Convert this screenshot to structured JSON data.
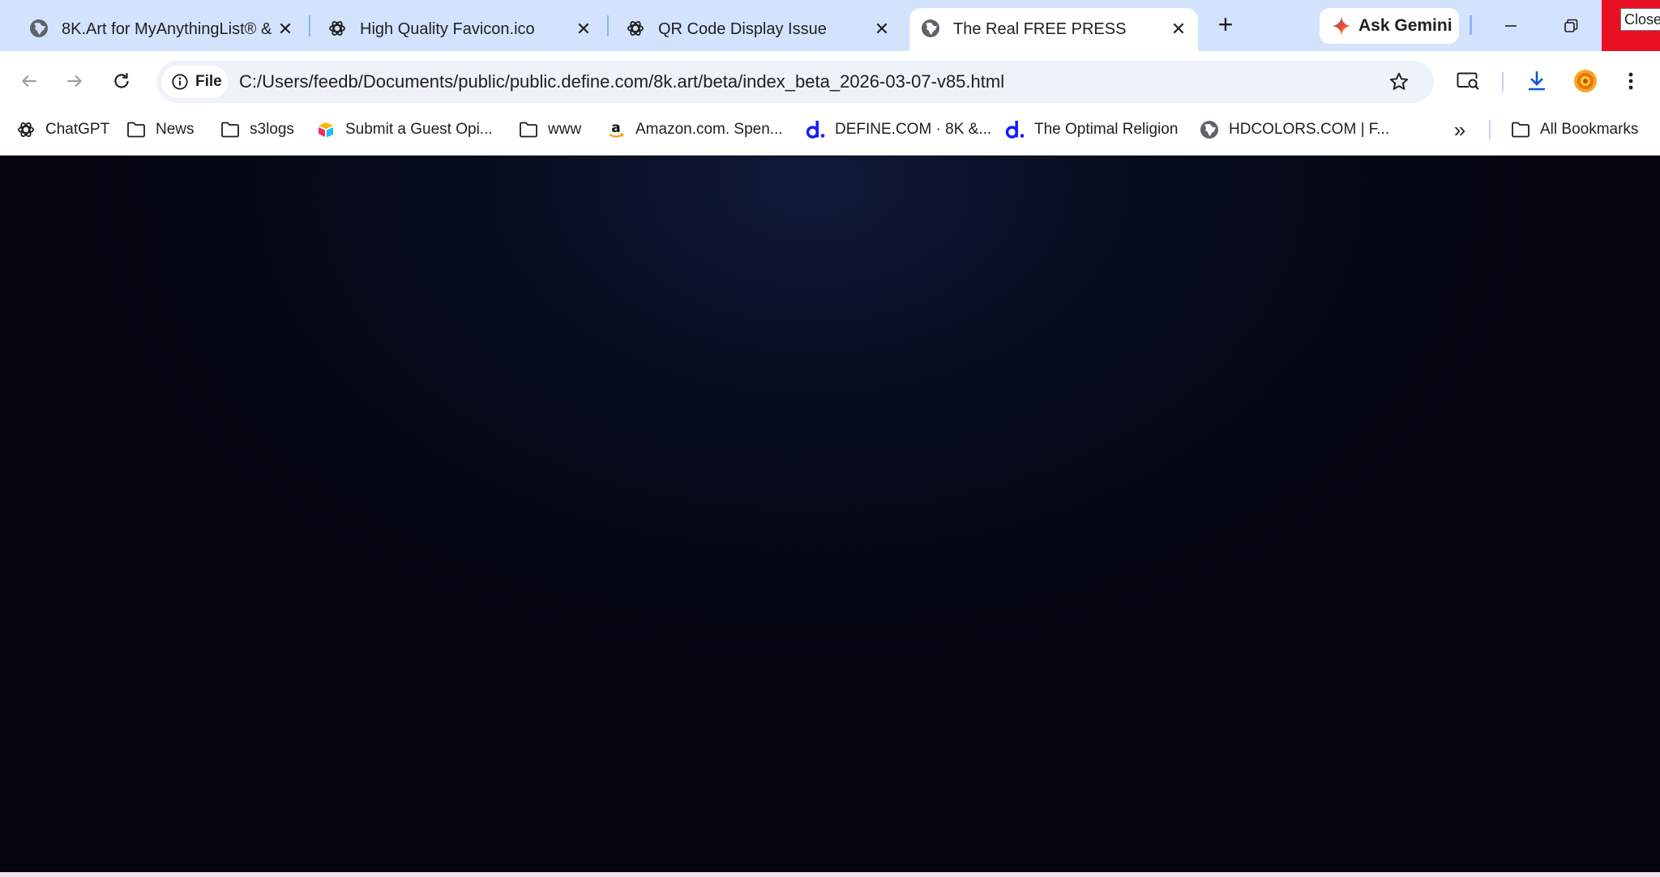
{
  "tabs": [
    {
      "title": "8K.Art for MyAnythingList® & ",
      "favicon": "globe-icon",
      "active": false
    },
    {
      "title": "High Quality Favicon.ico",
      "favicon": "chatgpt-icon",
      "active": false
    },
    {
      "title": "QR Code Display Issue",
      "favicon": "chatgpt-icon",
      "active": false
    },
    {
      "title": "The Real FREE PRESS",
      "favicon": "globe-icon",
      "active": true
    }
  ],
  "gemini": {
    "label": "Ask Gemini"
  },
  "window": {
    "close_tooltip": "Close"
  },
  "omnibox": {
    "chip_label": "File",
    "url": "C:/Users/feedb/Documents/public/public.define.com/8k.art/beta/index_beta_2026-03-07-v85.html"
  },
  "bookmarks": [
    {
      "label": "ChatGPT",
      "icon": "chatgpt-icon"
    },
    {
      "label": "News",
      "icon": "folder-icon"
    },
    {
      "label": "s3logs",
      "icon": "folder-icon"
    },
    {
      "label": "Submit a Guest Opi...",
      "icon": "airtable-icon"
    },
    {
      "label": "www",
      "icon": "folder-icon"
    },
    {
      "label": "Amazon.com. Spen...",
      "icon": "amazon-icon"
    },
    {
      "label": "DEFINE.COM · 8K &...",
      "icon": "define-d-icon"
    },
    {
      "label": "The Optimal Religion",
      "icon": "define-d-icon"
    },
    {
      "label": "HDCOLORS.COM | F...",
      "icon": "globe-icon"
    }
  ],
  "all_bookmarks": {
    "label": "All Bookmarks"
  },
  "colors": {
    "tabstrip": "#d3e3fd",
    "omnibox": "#eef2f9",
    "page_bg": "#030611",
    "close_red": "#e81123",
    "define_blue": "#1a1aff"
  }
}
